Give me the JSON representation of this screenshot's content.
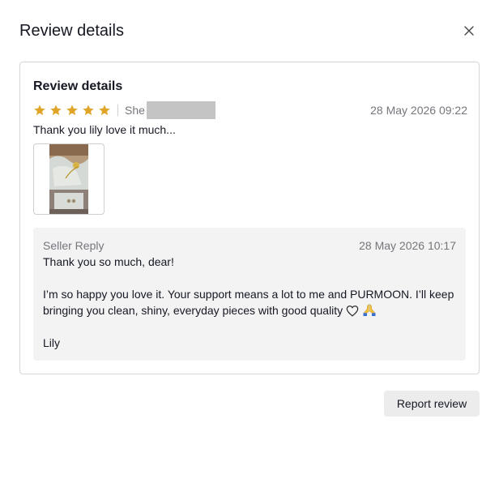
{
  "dialog": {
    "title": "Review details",
    "close_icon": "close-icon"
  },
  "review": {
    "section_title": "Review details",
    "rating": 5,
    "max_rating": 5,
    "star_color": "#e0a526",
    "reviewer_visible": "She",
    "date": "28 May 2026 09:22",
    "text": "Thank you lily love it much...",
    "photo_icon": "review-photo-thumbnail"
  },
  "seller_reply": {
    "label": "Seller Reply",
    "date": "28 May 2026 10:17",
    "line1": "Thank you so much, dear!",
    "line2": "I’m so happy you love it. Your support means a lot to me and PURMOON. I’ll keep bringing you clean, shiny, everyday pieces with good quality",
    "line3": "Lily",
    "emoji_icons": [
      "heart-icon",
      "praying-hands-icon"
    ]
  },
  "actions": {
    "report_label": "Report review"
  }
}
